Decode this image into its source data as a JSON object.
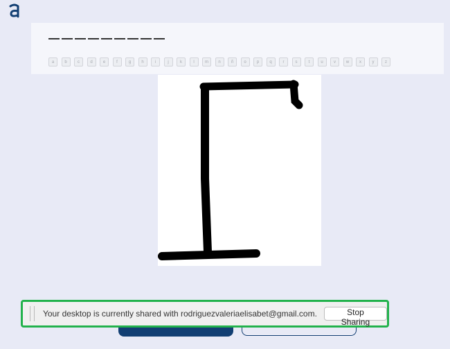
{
  "app": {
    "logo_icon": "amazon-a-logo-icon",
    "brand_color": "#123f73"
  },
  "game": {
    "word_blank_count": 9,
    "letters": [
      "a",
      "b",
      "c",
      "d",
      "e",
      "f",
      "g",
      "h",
      "i",
      "j",
      "k",
      "l",
      "m",
      "n",
      "ñ",
      "o",
      "p",
      "q",
      "r",
      "s",
      "t",
      "u",
      "v",
      "w",
      "x",
      "y",
      "z"
    ],
    "hangman_stage": "gallows"
  },
  "share_bar": {
    "message": "Your desktop is currently shared with rodriguezvaleriaelisabet@gmail.com.",
    "stop_label": "Stop Sharing",
    "accent": "#22b24c"
  }
}
